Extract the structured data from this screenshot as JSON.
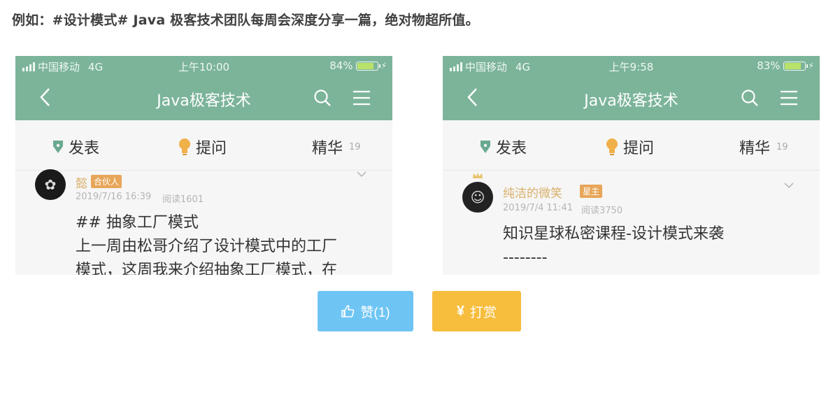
{
  "caption": "例如：#设计模式# Java 极客技术团队每周会深度分享一篇，绝对物超所值。",
  "phones": [
    {
      "status": {
        "carrier": "中国移动",
        "network": "4G",
        "time": "上午10:00",
        "battery": "84%",
        "battery_level": 0.84
      },
      "nav": {
        "title": "Java极客技术"
      },
      "tabs": {
        "post": "发表",
        "ask": "提问",
        "featured": "精华",
        "featured_count": "19"
      },
      "post": {
        "username": "懿",
        "badge": "合伙人",
        "date": "2019/7/16 16:39",
        "reads": "阅读1601",
        "lines": [
          "## 抽象工厂模式",
          "上一周由松哥介绍了设计模式中的工厂",
          "模式，这周我来介绍抽象工厂模式，在"
        ]
      }
    },
    {
      "status": {
        "carrier": "中国移动",
        "network": "4G",
        "time": "上午9:58",
        "battery": "83%",
        "battery_level": 0.83
      },
      "nav": {
        "title": "Java极客技术"
      },
      "tabs": {
        "post": "发表",
        "ask": "提问",
        "featured": "精华",
        "featured_count": "19"
      },
      "post": {
        "username": "纯洁的微笑",
        "badge": "星主",
        "date": "2019/7/4 11:41",
        "reads": "阅读3750",
        "lines": [
          "知识星球私密课程-设计模式来袭",
          "--------"
        ]
      }
    }
  ],
  "actions": {
    "like_label": "赞(1)",
    "reward_label": "打赏",
    "reward_symbol": "¥"
  },
  "colors": {
    "appbar": "#7cb49a",
    "like": "#6ec5f4",
    "reward": "#f7bd3d",
    "badge": "#e7a659"
  }
}
